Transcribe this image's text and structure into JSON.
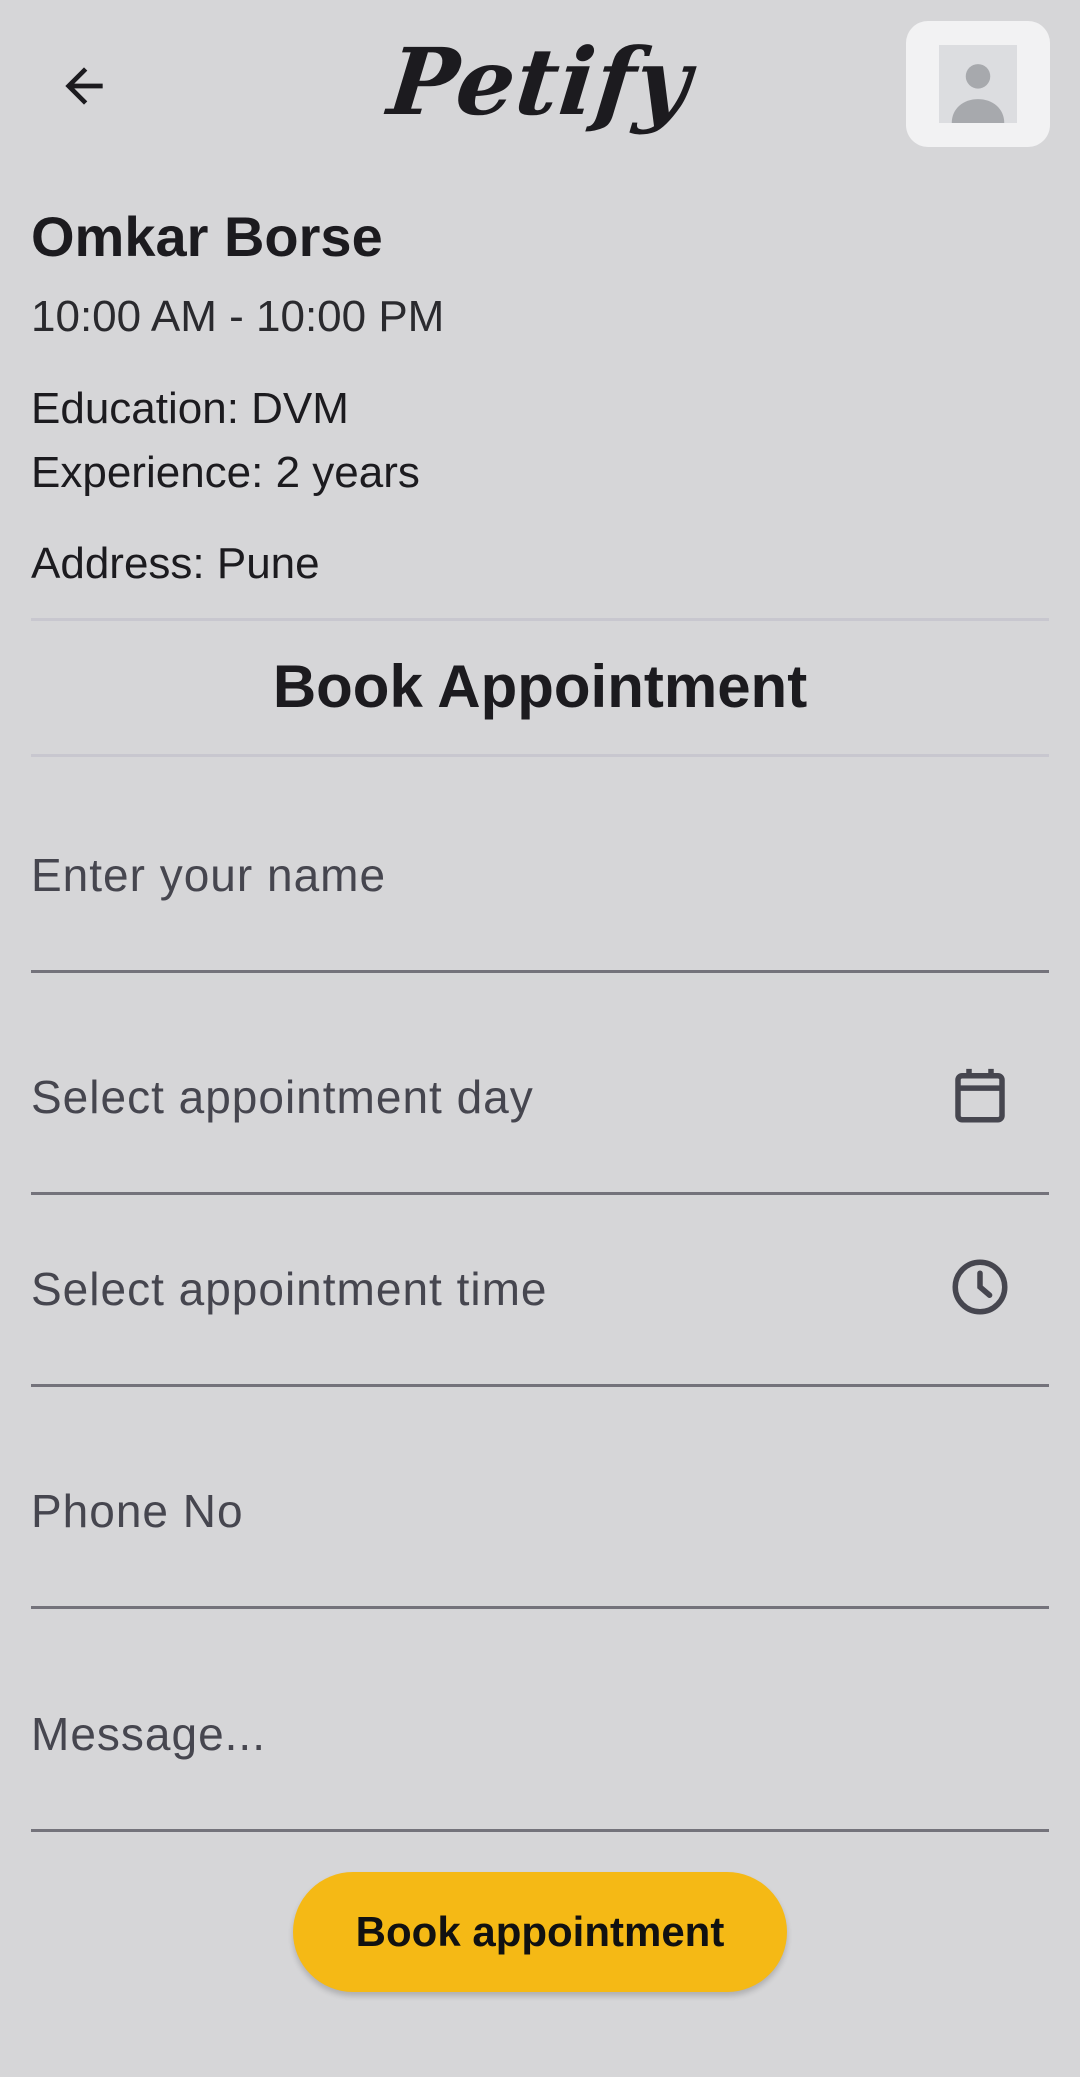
{
  "app": {
    "title": "Petify"
  },
  "doctor": {
    "name": "Omkar Borse",
    "hours": "10:00 AM - 10:00 PM",
    "education": "Education: DVM",
    "experience": "Experience: 2 years",
    "address": "Address: Pune"
  },
  "form": {
    "title": "Book Appointment",
    "name_label": "Enter your name",
    "day_label": "Select appointment day",
    "time_label": "Select appointment time",
    "phone_label": "Phone No",
    "message_label": "Message...",
    "submit_label": "Book appointment"
  },
  "icons": {
    "back": "arrow-back-icon",
    "avatar": "user-avatar-icon",
    "calendar": "calendar-icon",
    "clock": "clock-icon"
  },
  "colors": {
    "background": "#d6d6d8",
    "accent": "#f5b915",
    "text": "#1c1b1f"
  }
}
